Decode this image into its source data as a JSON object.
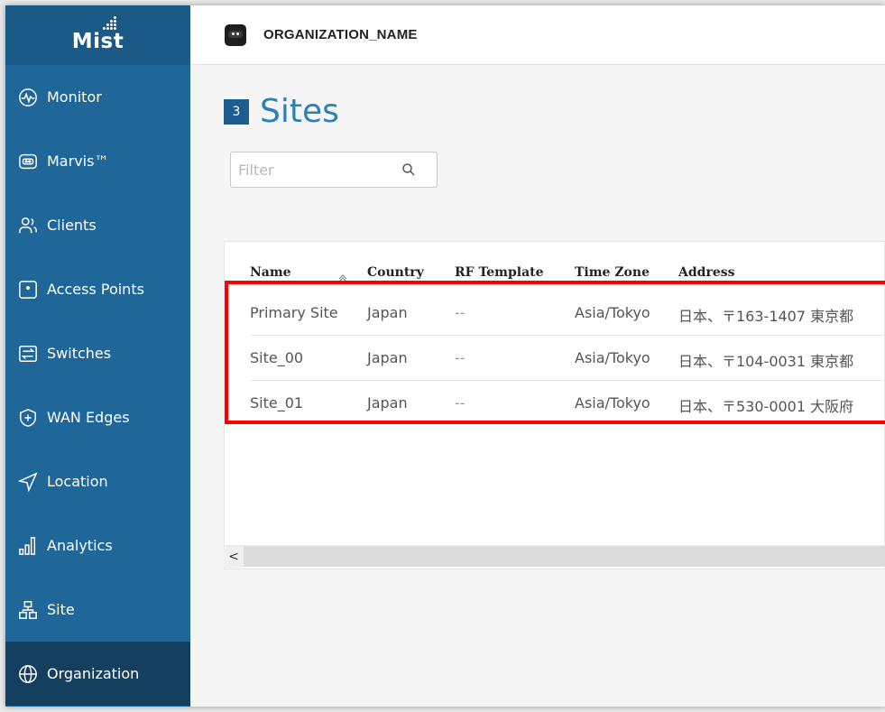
{
  "app": {
    "logo_text": "Mist",
    "org_name": "ORGANIZATION_NAME"
  },
  "sidebar": {
    "items": [
      {
        "label": "Monitor",
        "icon": "monitor-icon"
      },
      {
        "label": "Marvis™",
        "icon": "marvis-icon"
      },
      {
        "label": "Clients",
        "icon": "clients-icon"
      },
      {
        "label": "Access Points",
        "icon": "access-point-icon"
      },
      {
        "label": "Switches",
        "icon": "switch-icon"
      },
      {
        "label": "WAN Edges",
        "icon": "wan-edge-icon"
      },
      {
        "label": "Location",
        "icon": "location-icon"
      },
      {
        "label": "Analytics",
        "icon": "analytics-icon"
      },
      {
        "label": "Site",
        "icon": "site-icon"
      },
      {
        "label": "Organization",
        "icon": "globe-icon",
        "active": true
      }
    ]
  },
  "page": {
    "count": "3",
    "title": "Sites",
    "filter_placeholder": "Filter"
  },
  "table": {
    "columns": [
      "Name",
      "Country",
      "RF Template",
      "Time Zone",
      "Address"
    ],
    "rows": [
      [
        "Primary Site",
        "Japan",
        "--",
        "Asia/Tokyo",
        "日本、〒163-1407 東京都"
      ],
      [
        "Site_00",
        "Japan",
        "--",
        "Asia/Tokyo",
        "日本、〒104-0031 東京都"
      ],
      [
        "Site_01",
        "Japan",
        "--",
        "Asia/Tokyo",
        "日本、〒530-0001 大阪府"
      ]
    ]
  },
  "scrollbar": {
    "left_arrow": "<"
  },
  "colors": {
    "sidebar_bg": "#1f6699",
    "sidebar_active": "#153f5f",
    "title_blue": "#2c7fb8",
    "highlight_red": "#ff0000"
  }
}
